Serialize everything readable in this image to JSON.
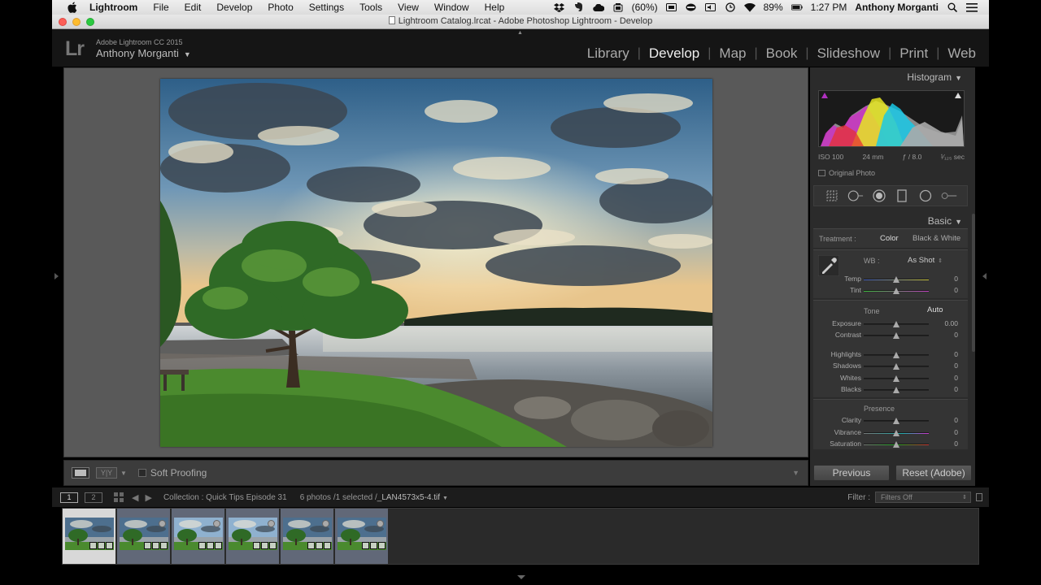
{
  "menubar": {
    "app_name": "Lightroom",
    "items": [
      "File",
      "Edit",
      "Develop",
      "Photo",
      "Settings",
      "Tools",
      "View",
      "Window",
      "Help"
    ],
    "battery_percent_label": "(60%)",
    "battery_level": "89%",
    "time": "1:27 PM",
    "user": "Anthony Morganti"
  },
  "window": {
    "title": "Lightroom Catalog.lrcat - Adobe Photoshop Lightroom - Develop"
  },
  "identity": {
    "logo": "Lr",
    "product": "Adobe Lightroom CC 2015",
    "owner": "Anthony Morganti"
  },
  "modules": {
    "items": [
      "Library",
      "Develop",
      "Map",
      "Book",
      "Slideshow",
      "Print",
      "Web"
    ],
    "active": "Develop"
  },
  "toolbar": {
    "yy_label": "Y|Y",
    "soft_proofing": "Soft Proofing"
  },
  "histogram": {
    "title": "Histogram",
    "iso": "ISO 100",
    "focal": "24 mm",
    "aperture": "ƒ / 8.0",
    "shutter": "¹⁄₁₂₅ sec",
    "original_photo": "Original Photo"
  },
  "basic": {
    "title": "Basic",
    "treatment_label": "Treatment :",
    "color": "Color",
    "bw": "Black & White",
    "wb_label": "WB :",
    "wb_value": "As Shot",
    "tone_label": "Tone",
    "auto": "Auto",
    "presence_label": "Presence",
    "sliders": [
      {
        "name": "Temp",
        "value": "0",
        "pos": 0.5
      },
      {
        "name": "Tint",
        "value": "0",
        "pos": 0.5
      },
      {
        "name": "Exposure",
        "value": "0.00",
        "pos": 0.5
      },
      {
        "name": "Contrast",
        "value": "0",
        "pos": 0.5
      },
      {
        "name": "Highlights",
        "value": "0",
        "pos": 0.5
      },
      {
        "name": "Shadows",
        "value": "0",
        "pos": 0.5
      },
      {
        "name": "Whites",
        "value": "0",
        "pos": 0.5
      },
      {
        "name": "Blacks",
        "value": "0",
        "pos": 0.5
      },
      {
        "name": "Clarity",
        "value": "0",
        "pos": 0.5
      },
      {
        "name": "Vibrance",
        "value": "0",
        "pos": 0.5
      },
      {
        "name": "Saturation",
        "value": "0",
        "pos": 0.5
      }
    ]
  },
  "panel_buttons": {
    "previous": "Previous",
    "reset": "Reset (Adobe)"
  },
  "filmstrip_nav": {
    "screen1": "1",
    "screen2": "2",
    "collection": "Collection : Quick Tips Episode 31",
    "count": "6 photos /1 selected /",
    "filename": "_LAN4573x5-4.tif",
    "filter_label": "Filter :",
    "filter_value": "Filters Off"
  },
  "colors": {
    "accent_selected": "#d8d8d8",
    "cell_bg": "#616878",
    "canvas_bg": "#595959"
  }
}
